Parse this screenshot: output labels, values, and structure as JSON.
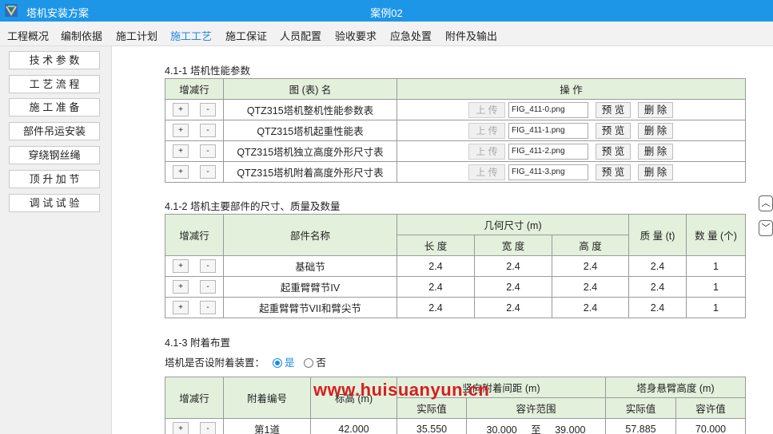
{
  "titlebar": {
    "app_title": "塔机安装方案",
    "case_title": "案例02"
  },
  "menu": [
    {
      "label": "工程概况"
    },
    {
      "label": "编制依据"
    },
    {
      "label": "施工计划"
    },
    {
      "label": "施工工艺"
    },
    {
      "label": "施工保证"
    },
    {
      "label": "人员配置"
    },
    {
      "label": "验收要求"
    },
    {
      "label": "应急处置"
    },
    {
      "label": "附件及输出"
    }
  ],
  "active_menu": "施工工艺",
  "sidebar": [
    {
      "label": "技 术 参 数"
    },
    {
      "label": "工 艺 流 程"
    },
    {
      "label": "施 工 准 备"
    },
    {
      "label": "部件吊运安装"
    },
    {
      "label": "穿绕钢丝绳"
    },
    {
      "label": "顶 升 加 节"
    },
    {
      "label": "调 试 试 验"
    }
  ],
  "section1": {
    "title": "4.1-1  塔机性能参数",
    "headers": {
      "adddel": "增减行",
      "name": "图 (表) 名",
      "ops": "操  作"
    },
    "plus": "+",
    "minus": "-",
    "upload": "上 传",
    "preview": "预 览",
    "delete": "删 除",
    "rows": [
      {
        "name": "QTZ315塔机整机性能参数表",
        "file": "FIG_411-0.png"
      },
      {
        "name": "QTZ315塔机起重性能表",
        "file": "FIG_411-1.png"
      },
      {
        "name": "QTZ315塔机独立高度外形尺寸表",
        "file": "FIG_411-2.png"
      },
      {
        "name": "QTZ315塔机附着高度外形尺寸表",
        "file": "FIG_411-3.png"
      }
    ]
  },
  "section2": {
    "title": "4.1-2  塔机主要部件的尺寸、质量及数量",
    "headers": {
      "adddel": "增减行",
      "part": "部件名称",
      "geom": "几何尺寸 (m)",
      "length": "长 度",
      "width": "宽 度",
      "height": "高 度",
      "mass": "质 量 (t)",
      "qty": "数 量 (个)"
    },
    "rows": [
      {
        "name": "基础节",
        "length": "2.4",
        "width": "2.4",
        "height": "2.4",
        "mass": "2.4",
        "qty": "1"
      },
      {
        "name": "起重臂臂节IV",
        "length": "2.4",
        "width": "2.4",
        "height": "2.4",
        "mass": "2.4",
        "qty": "1"
      },
      {
        "name": "起重臂臂节VII和臂尖节",
        "length": "2.4",
        "width": "2.4",
        "height": "2.4",
        "mass": "2.4",
        "qty": "1"
      }
    ]
  },
  "section3": {
    "title": "4.1-3  附着布置",
    "question": "塔机是否设附着装置：",
    "yes": "是",
    "no": "否",
    "selected": "是",
    "headers": {
      "adddel": "增减行",
      "no": "附着编号",
      "elev": "标高 (m)",
      "spacing": "竖向附着间距 (m)",
      "actual": "实际值",
      "range": "容许范围",
      "cantilever": "塔身悬臂高度 (m)",
      "actual2": "实际值",
      "allowed": "容许值"
    },
    "rows": [
      {
        "no": "第1道",
        "elev": "42.000",
        "actual": "35.550",
        "range_min": "30.000",
        "to": "至",
        "range_max": "39.000",
        "cant_actual": "57.885",
        "cant_allowed": "70.000"
      }
    ]
  },
  "watermark": "www.huisuanyun.cn",
  "scroll": {
    "up": "︿",
    "down": "﹀"
  }
}
